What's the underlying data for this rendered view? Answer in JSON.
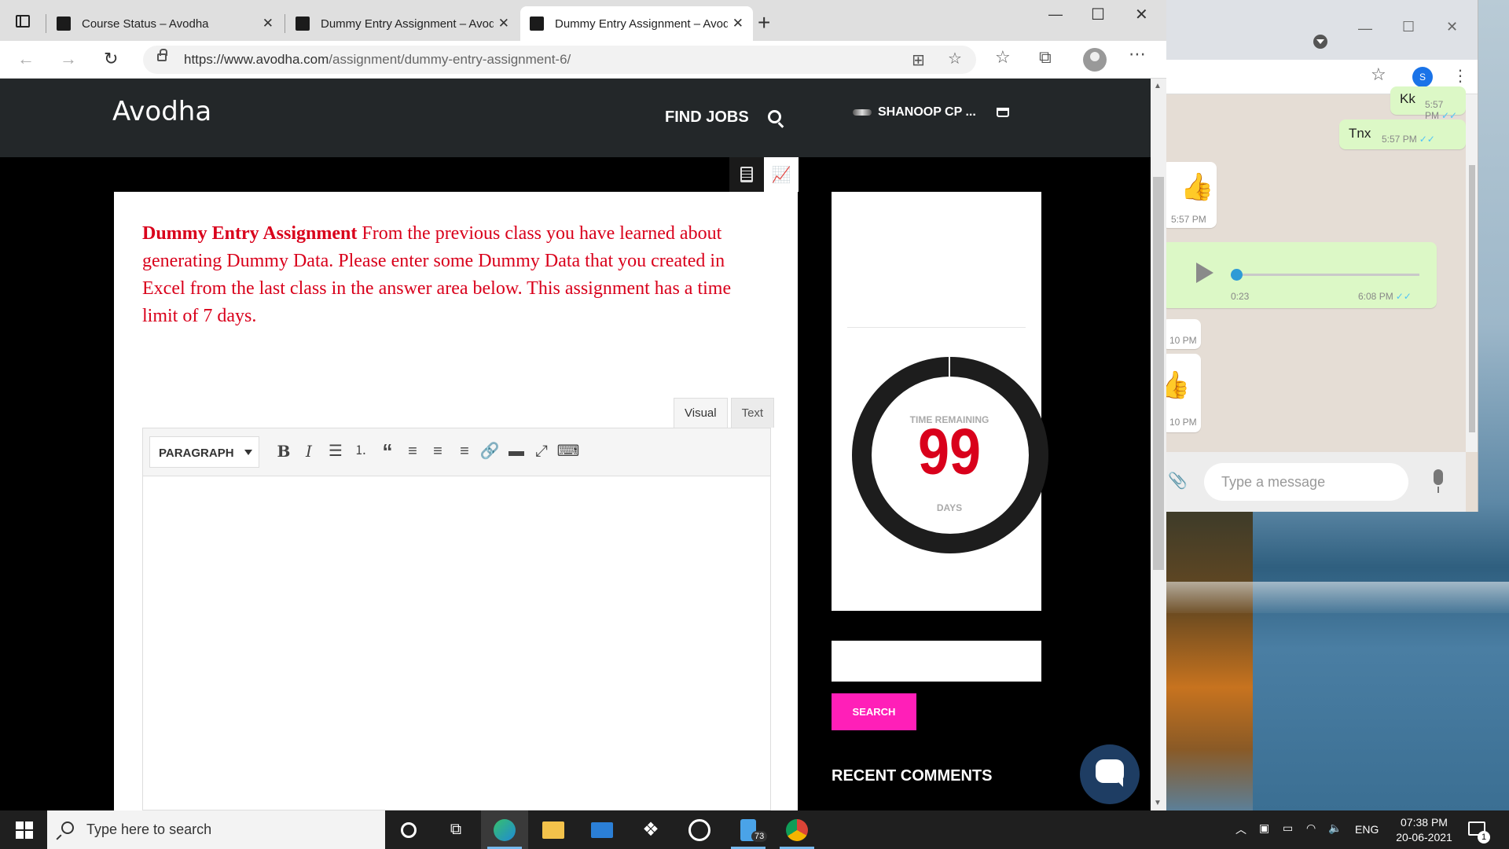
{
  "browser": {
    "tabs": [
      {
        "title": "Course Status – Avodha"
      },
      {
        "title": "Dummy Entry Assignment – Avodha"
      },
      {
        "title": "Dummy Entry Assignment – Avodha"
      }
    ],
    "url_host": "https://www.avodha.com",
    "url_path": "/assignment/dummy-entry-assignment-6/"
  },
  "site": {
    "logo": "Avodha",
    "nav_find_jobs": "FIND JOBS",
    "user_name": "SHANOOP CP ...",
    "assignment_title": "Dummy Entry Assignment",
    "assignment_body": "From the previous class you have learned about generating Dummy Data. Please enter some Dummy Data that you created in Excel from the last class in the answer area below. This assignment has a time limit of 7 days.",
    "editor": {
      "tab_visual": "Visual",
      "tab_text": "Text",
      "format_select": "PARAGRAPH"
    },
    "timer": {
      "label_top": "TIME REMAINING",
      "value": "99",
      "label_bottom": "DAYS"
    },
    "search_button": "SEARCH",
    "recent_comments": "RECENT COMMENTS"
  },
  "whatsapp": {
    "profile_initial": "S",
    "messages": [
      {
        "text": "Kk",
        "time": "5:57 PM"
      },
      {
        "text": "Tnx",
        "time": "5:57 PM"
      },
      {
        "text": "👍",
        "time": "5:57 PM"
      },
      {
        "voice_duration": "0:23",
        "time": "6:08 PM"
      },
      {
        "text": "",
        "time": "10 PM"
      },
      {
        "text": "👍",
        "time": "10 PM"
      }
    ],
    "input_placeholder": "Type a message"
  },
  "taskbar": {
    "search_placeholder": "Type here to search",
    "badge_count": "73",
    "lang": "ENG",
    "time": "07:38 PM",
    "date": "20-06-2021",
    "notification_count": "1"
  }
}
